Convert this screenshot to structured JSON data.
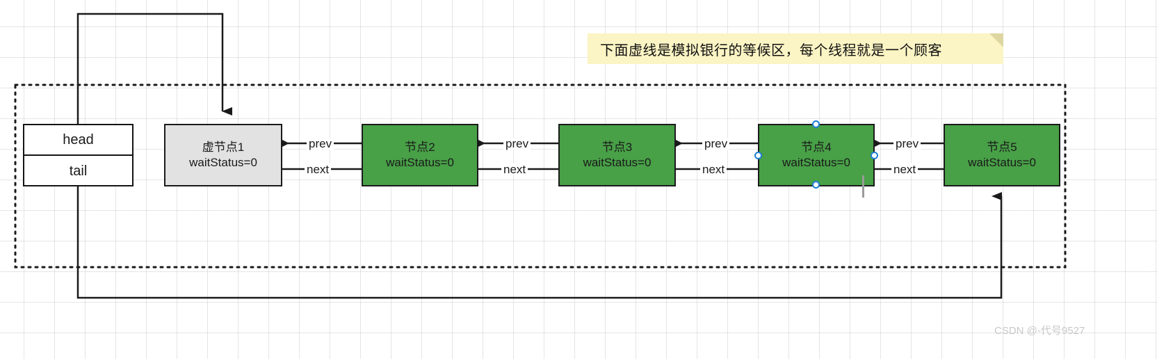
{
  "diagram": {
    "title": "AQS CLH queue linked list diagram",
    "note": {
      "text": "下面虚线是模拟银行的等候区，每个线程就是一个顾客"
    },
    "head_tail": {
      "head_label": "head",
      "tail_label": "tail"
    },
    "nodes": [
      {
        "id": "node1",
        "title": "虚节点1",
        "status": "waitStatus=0",
        "color": "#e2e2e2",
        "selected": false
      },
      {
        "id": "node2",
        "title": "节点2",
        "status": "waitStatus=0",
        "color": "#48a047",
        "selected": false
      },
      {
        "id": "node3",
        "title": "节点3",
        "status": "waitStatus=0",
        "color": "#48a047",
        "selected": false
      },
      {
        "id": "node4",
        "title": "节点4",
        "status": "waitStatus=0",
        "color": "#48a047",
        "selected": true
      },
      {
        "id": "node5",
        "title": "节点5",
        "status": "waitStatus=0",
        "color": "#48a047",
        "selected": false
      }
    ],
    "edge_labels": {
      "prev": "prev",
      "next": "next"
    },
    "link_pairs": [
      {
        "from": "node2",
        "to": "node1",
        "prev": "prev",
        "next": "next"
      },
      {
        "from": "node3",
        "to": "node2",
        "prev": "prev",
        "next": "next"
      },
      {
        "from": "node4",
        "to": "node3",
        "prev": "prev",
        "next": "next"
      },
      {
        "from": "node5",
        "to": "node4",
        "prev": "prev",
        "next": "next"
      }
    ],
    "colors": {
      "node_green": "#48a047",
      "node_gray": "#e2e2e2",
      "note_yellow": "#fbf4c4",
      "note_fold": "#ddd6a0",
      "stroke": "#1a1a1a",
      "selection_handle": "#1f7fd4",
      "grid": "#aaaaaa"
    },
    "watermark": "CSDN @-代号9527"
  }
}
